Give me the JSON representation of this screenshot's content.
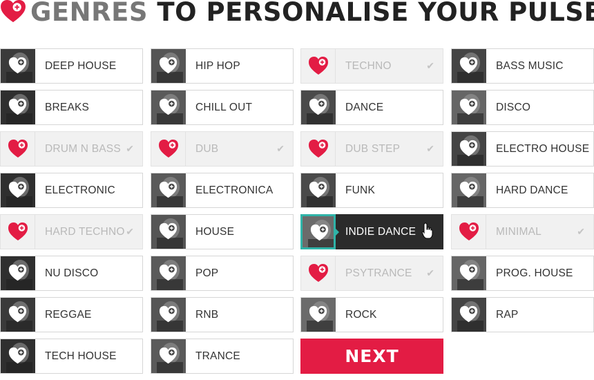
{
  "header": {
    "title_highlight": "GENRES",
    "title_rest": " TO PERSONALISE YOUR PULSE"
  },
  "colors": {
    "accent": "#e31c44",
    "active_bg": "#2b2b2b",
    "active_border": "#2fb3a8",
    "selected_bg": "#f1f1f1"
  },
  "genres": [
    {
      "label": "DEEP HOUSE",
      "state": "default"
    },
    {
      "label": "HIP HOP",
      "state": "default"
    },
    {
      "label": "TECHNO",
      "state": "selected"
    },
    {
      "label": "BASS MUSIC",
      "state": "default"
    },
    {
      "label": "BREAKS",
      "state": "default"
    },
    {
      "label": "CHILL OUT",
      "state": "default"
    },
    {
      "label": "DANCE",
      "state": "default"
    },
    {
      "label": "DISCO",
      "state": "default"
    },
    {
      "label": "DRUM N BASS",
      "state": "selected"
    },
    {
      "label": "DUB",
      "state": "selected"
    },
    {
      "label": "DUB STEP",
      "state": "selected"
    },
    {
      "label": "ELECTRO HOUSE",
      "state": "default"
    },
    {
      "label": "ELECTRONIC",
      "state": "default"
    },
    {
      "label": "ELECTRONICA",
      "state": "default"
    },
    {
      "label": "FUNK",
      "state": "default"
    },
    {
      "label": "HARD DANCE",
      "state": "default"
    },
    {
      "label": "HARD TECHNO",
      "state": "selected"
    },
    {
      "label": "HOUSE",
      "state": "default"
    },
    {
      "label": "INDIE DANCE",
      "state": "active"
    },
    {
      "label": "MINIMAL",
      "state": "selected"
    },
    {
      "label": "NU DISCO",
      "state": "default"
    },
    {
      "label": "POP",
      "state": "default"
    },
    {
      "label": "PSYTRANCE",
      "state": "selected"
    },
    {
      "label": "PROG. HOUSE",
      "state": "default"
    },
    {
      "label": "REGGAE",
      "state": "default"
    },
    {
      "label": "RNB",
      "state": "default"
    },
    {
      "label": "ROCK",
      "state": "default"
    },
    {
      "label": "RAP",
      "state": "default"
    },
    {
      "label": "TECH HOUSE",
      "state": "default"
    },
    {
      "label": "TRANCE",
      "state": "default"
    }
  ],
  "next_button": {
    "label": "NEXT"
  }
}
